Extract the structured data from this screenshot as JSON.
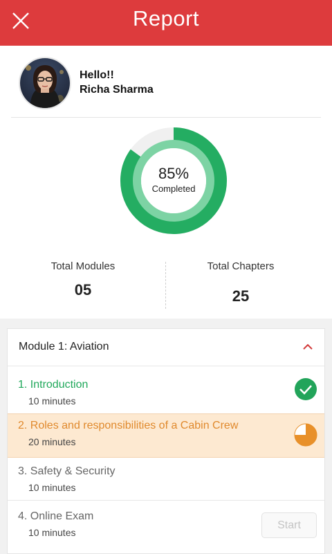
{
  "header": {
    "title": "Report",
    "close_icon": "close-icon",
    "color": "#dd3b3d"
  },
  "profile": {
    "greeting": "Hello!!",
    "name": "Richa Sharma"
  },
  "progress": {
    "percent": 85,
    "value_label": "85%",
    "caption": "Completed",
    "ring_color": "#24ad62",
    "inner_color": "#7dd3a4",
    "track_color": "#f0f0f0"
  },
  "stats": {
    "modules_label": "Total Modules",
    "modules_value": "05",
    "chapters_label": "Total Chapters",
    "chapters_value": "25"
  },
  "module": {
    "title": "Module 1: Aviation",
    "expand_icon": "chevron-up-icon",
    "chapters": [
      {
        "title": "1. Introduction",
        "duration": "10 minutes",
        "status": "completed",
        "status_icon": "check-circle-icon",
        "color": "#1fa85a"
      },
      {
        "title": "2. Roles and responsibilities of a Cabin Crew",
        "duration": "20 minutes",
        "status": "in-progress",
        "status_icon": "pie-progress-icon",
        "progress": 0.75,
        "color": "#e0892c"
      },
      {
        "title": "3. Safety & Security",
        "duration": "10 minutes",
        "status": "locked"
      },
      {
        "title": "4. Online Exam",
        "duration": "10 minutes",
        "status": "not-started",
        "action_label": "Start"
      }
    ]
  }
}
